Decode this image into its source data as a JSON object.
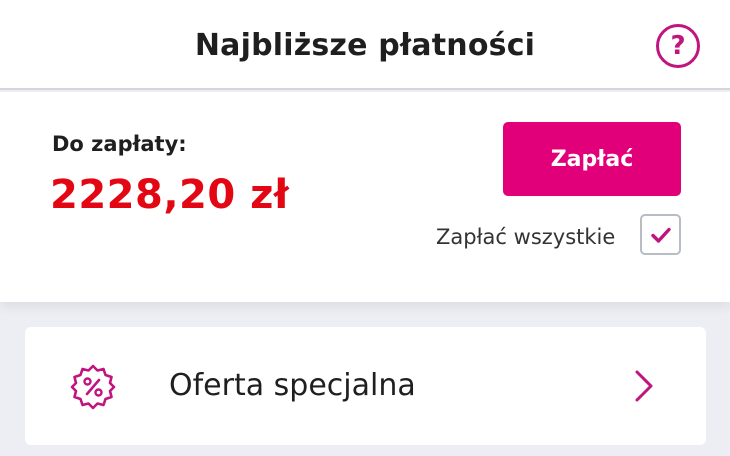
{
  "header": {
    "title": "Najbliższe płatności",
    "help_icon": "question-circle-icon",
    "help_symbol": "?"
  },
  "payment": {
    "due_label": "Do zapłaty:",
    "due_amount": "2228,20 zł",
    "pay_button_label": "Zapłać",
    "pay_all_label": "Zapłać wszystkie",
    "pay_all_checked": true
  },
  "offer": {
    "label": "Oferta specjalna",
    "icon": "percent-badge-icon",
    "chevron": "chevron-right-icon"
  },
  "colors": {
    "accent": "#e2007a",
    "icon_accent": "#c0147f",
    "amount": "#e30613",
    "background": "#eceef3"
  }
}
